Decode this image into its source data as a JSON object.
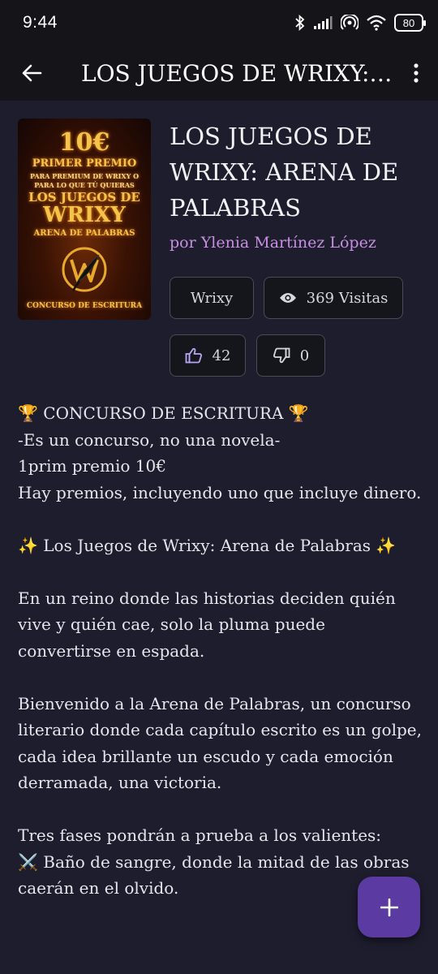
{
  "status": {
    "time": "9:44",
    "battery": "80"
  },
  "appbar": {
    "title": "LOS JUEGOS DE WRIXY: ARENA DE PALABRAS"
  },
  "cover": {
    "line1": "10€",
    "line2": "PRIMER PREMIO",
    "line3": "PARA PREMIUM DE WRIXY O",
    "line4": "PARA LO QUE TÚ QUIERAS",
    "line5": "LOS JUEGOS DE",
    "line6": "WRIXY",
    "line7": "ARENA DE PALABRAS",
    "line8": "CONCURSO DE ESCRITURA"
  },
  "book": {
    "title_line1": "LOS JUEGOS DE",
    "title_line2": "WRIXY: ARENA DE",
    "title_line3": "PALABRAS",
    "author": "por Ylenia Martínez López",
    "tag": "Wrixy",
    "views": "369 Visitas",
    "likes": "42",
    "dislikes": "0"
  },
  "description": {
    "p1_l1": "🏆 CONCURSO DE ESCRITURA 🏆",
    "p1_l2": "-Es un concurso, no una novela-",
    "p1_l3": "1prim premio 10€",
    "p1_l4": "Hay premios, incluyendo uno que incluye dinero.",
    "p2": "✨ Los Juegos de Wrixy: Arena de Palabras ✨",
    "p3": "En un reino donde las historias deciden quién vive y quién cae, solo la pluma puede convertirse en espada.",
    "p4": "Bienvenido a la Arena de Palabras, un concurso literario donde cada capítulo escrito es un golpe, cada idea brillante un escudo y cada emoción derramada, una victoria.",
    "p5_l1": "Tres fases pondrán a prueba a los valientes:",
    "p5_l2": "⚔️ Baño de sangre, donde la mitad de las obras caerán en el olvido."
  },
  "colors": {
    "background": "#1d1d2d",
    "appbar": "#151519",
    "author": "#c98ee3",
    "fab": "#5b3aa2"
  }
}
